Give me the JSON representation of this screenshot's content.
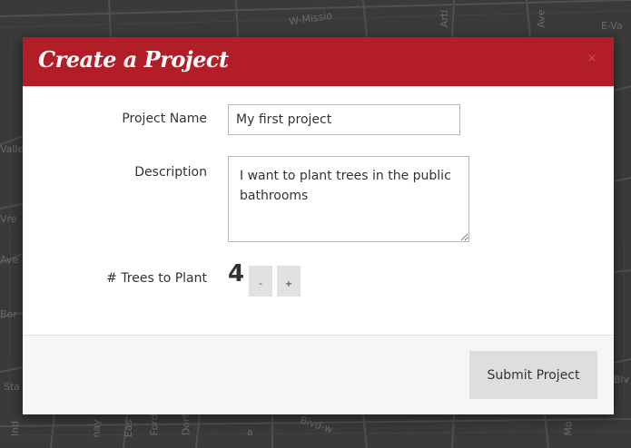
{
  "map": {
    "labels": [
      "W-Missio",
      "E-Va",
      "Valle",
      "Vre",
      "Ave",
      "Ber",
      "Ind",
      "Ford",
      "Bivd-w",
      "Blv",
      "Mo",
      "nay",
      "Eas",
      "Ave",
      "Arti",
      "Sta",
      "Dorf",
      "a"
    ]
  },
  "modal": {
    "title": "Create a Project",
    "close_label": "×",
    "fields": {
      "project_name_label": "Project Name",
      "project_name_value": "My first project",
      "description_label": "Description",
      "description_value": "I want to plant trees in the public bathrooms",
      "trees_label": "# Trees to Plant",
      "trees_count": "4",
      "decrement_label": "-",
      "increment_label": "+"
    },
    "footer": {
      "submit_label": "Submit Project"
    }
  },
  "colors": {
    "header_bg": "#b31d27",
    "footer_bg": "#f6f6f6",
    "button_bg": "#dedede",
    "map_bg": "#3a3a3a"
  }
}
